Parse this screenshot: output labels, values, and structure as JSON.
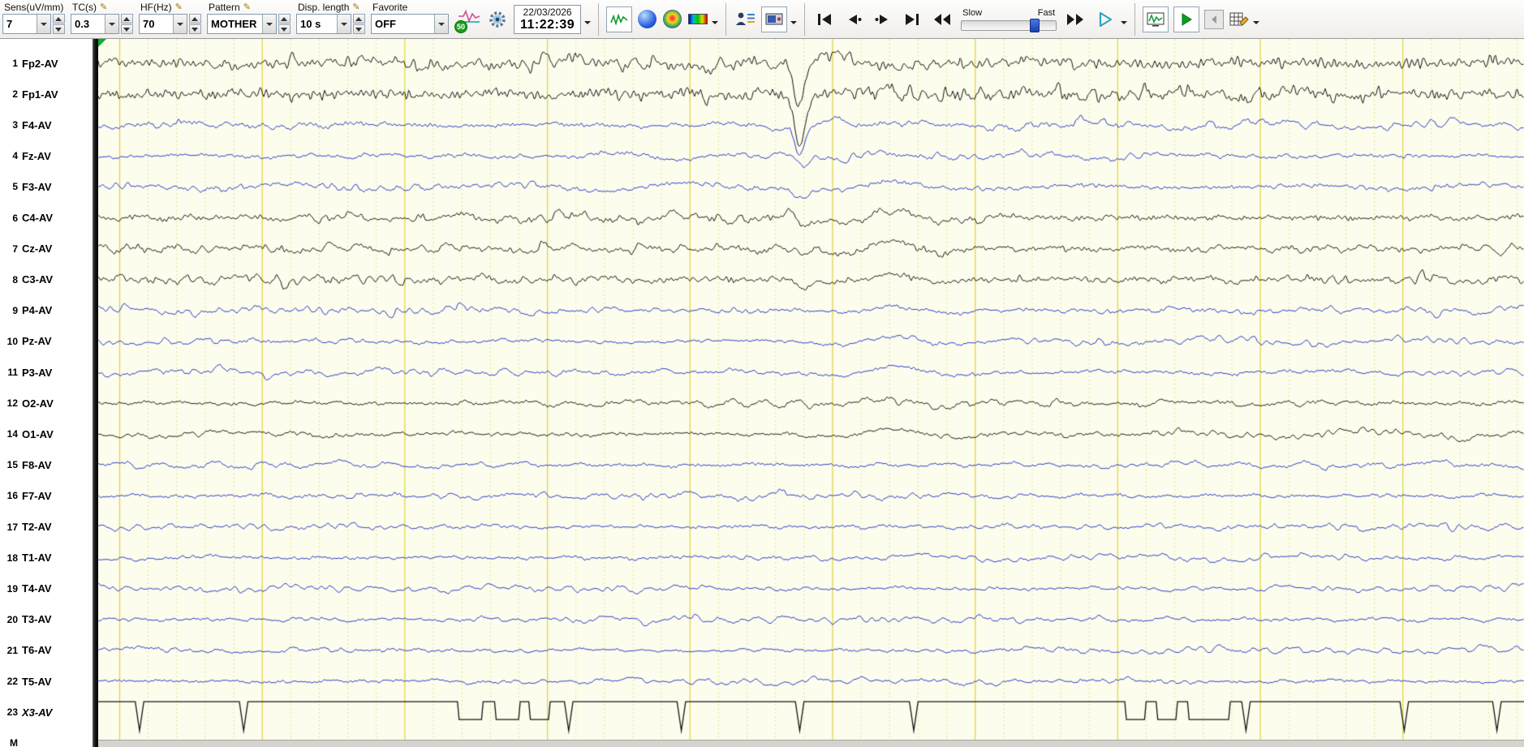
{
  "toolbar": {
    "sens": {
      "label": "Sens(uV/mm)",
      "value": "7"
    },
    "tc": {
      "label": "TC(s)",
      "value": "0.3"
    },
    "hf": {
      "label": "HF(Hz)",
      "value": "70"
    },
    "pattern": {
      "label": "Pattern",
      "value": "MOTHER"
    },
    "disp_length": {
      "label": "Disp. length",
      "value": "10 s"
    },
    "favorite": {
      "label": "Favorite",
      "value": "OFF"
    },
    "notch_value": "50",
    "datetime": {
      "date": "22/03/2026",
      "time": "11:22:39"
    },
    "speed_slider": {
      "slow": "Slow",
      "fast": "Fast"
    }
  },
  "display_seconds": 10,
  "channels": [
    {
      "num": "1",
      "label": "Fp2-AV",
      "color": "#141414",
      "amp": 4.6,
      "hf": 2.2
    },
    {
      "num": "2",
      "label": "Fp1-AV",
      "color": "#141414",
      "amp": 4.6,
      "hf": 2.4
    },
    {
      "num": "3",
      "label": "F4-AV",
      "color": "#2535c4",
      "amp": 3.0,
      "hf": 0.7
    },
    {
      "num": "4",
      "label": "Fz-AV",
      "color": "#2535c4",
      "amp": 2.8,
      "hf": 0.6
    },
    {
      "num": "5",
      "label": "F3-AV",
      "color": "#2535c4",
      "amp": 3.0,
      "hf": 0.7
    },
    {
      "num": "6",
      "label": "C4-AV",
      "color": "#141414",
      "amp": 3.2,
      "hf": 1.0
    },
    {
      "num": "7",
      "label": "Cz-AV",
      "color": "#141414",
      "amp": 3.6,
      "hf": 1.1
    },
    {
      "num": "8",
      "label": "C3-AV",
      "color": "#141414",
      "amp": 3.0,
      "hf": 1.0
    },
    {
      "num": "9",
      "label": "P4-AV",
      "color": "#2535c4",
      "amp": 3.0,
      "hf": 0.6
    },
    {
      "num": "10",
      "label": "Pz-AV",
      "color": "#2535c4",
      "amp": 2.6,
      "hf": 0.5
    },
    {
      "num": "11",
      "label": "P3-AV",
      "color": "#2535c4",
      "amp": 2.8,
      "hf": 0.5
    },
    {
      "num": "12",
      "label": "O2-AV",
      "color": "#141414",
      "amp": 2.6,
      "hf": 0.6
    },
    {
      "num": "14",
      "label": "O1-AV",
      "color": "#141414",
      "amp": 2.6,
      "hf": 0.6
    },
    {
      "num": "15",
      "label": "F8-AV",
      "color": "#2535c4",
      "amp": 2.4,
      "hf": 0.5
    },
    {
      "num": "16",
      "label": "F7-AV",
      "color": "#2535c4",
      "amp": 2.4,
      "hf": 0.5
    },
    {
      "num": "17",
      "label": "T2-AV",
      "color": "#2535c4",
      "amp": 2.4,
      "hf": 0.5
    },
    {
      "num": "18",
      "label": "T1-AV",
      "color": "#2535c4",
      "amp": 2.4,
      "hf": 0.5
    },
    {
      "num": "19",
      "label": "T4-AV",
      "color": "#2535c4",
      "amp": 2.6,
      "hf": 0.5
    },
    {
      "num": "20",
      "label": "T3-AV",
      "color": "#2535c4",
      "amp": 2.6,
      "hf": 0.5
    },
    {
      "num": "21",
      "label": "T6-AV",
      "color": "#2535c4",
      "amp": 2.2,
      "hf": 0.4
    },
    {
      "num": "22",
      "label": "T5-AV",
      "color": "#2535c4",
      "amp": 2.2,
      "hf": 0.4
    },
    {
      "num": "23",
      "label": "X3-AV",
      "color": "#141414",
      "italic": true,
      "kind": "event"
    },
    {
      "num": "M",
      "label": "",
      "color": "#141414",
      "kind": "marker"
    }
  ],
  "x3_events": {
    "dips_s": [
      0.29,
      1.02,
      3.3,
      4.09,
      4.92,
      5.72,
      8.05,
      9.16,
      9.81
    ],
    "pulses_s": [
      [
        2.52,
        2.7
      ],
      [
        2.78,
        2.96
      ],
      [
        3.02,
        3.17
      ],
      [
        7.2,
        7.35
      ],
      [
        7.42,
        7.57
      ],
      [
        7.64,
        7.94
      ]
    ]
  },
  "colors": {
    "bg": "#fdfdee",
    "grid_major": "#ded33e",
    "grid_minor": "#e9e290",
    "trace_black": "#141414",
    "trace_blue": "#2535c4",
    "marker_green": "#0ab026",
    "play_teal": "#2fa3c6"
  }
}
